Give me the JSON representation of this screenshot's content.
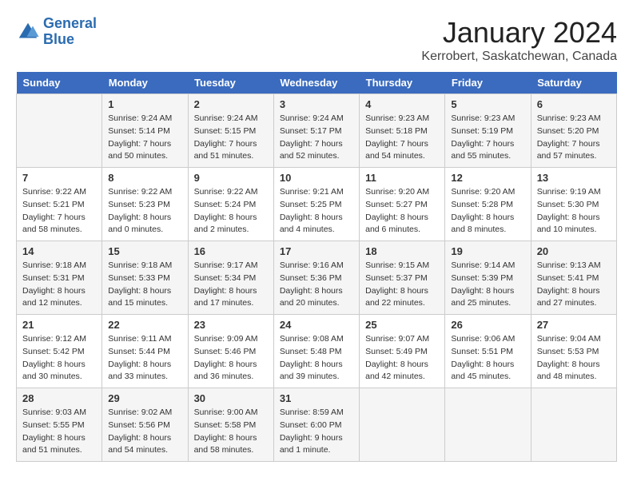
{
  "header": {
    "logo_line1": "General",
    "logo_line2": "Blue",
    "title": "January 2024",
    "location": "Kerrobert, Saskatchewan, Canada"
  },
  "days_of_week": [
    "Sunday",
    "Monday",
    "Tuesday",
    "Wednesday",
    "Thursday",
    "Friday",
    "Saturday"
  ],
  "weeks": [
    [
      {
        "day": "",
        "info": ""
      },
      {
        "day": "1",
        "info": "Sunrise: 9:24 AM\nSunset: 5:14 PM\nDaylight: 7 hours\nand 50 minutes."
      },
      {
        "day": "2",
        "info": "Sunrise: 9:24 AM\nSunset: 5:15 PM\nDaylight: 7 hours\nand 51 minutes."
      },
      {
        "day": "3",
        "info": "Sunrise: 9:24 AM\nSunset: 5:17 PM\nDaylight: 7 hours\nand 52 minutes."
      },
      {
        "day": "4",
        "info": "Sunrise: 9:23 AM\nSunset: 5:18 PM\nDaylight: 7 hours\nand 54 minutes."
      },
      {
        "day": "5",
        "info": "Sunrise: 9:23 AM\nSunset: 5:19 PM\nDaylight: 7 hours\nand 55 minutes."
      },
      {
        "day": "6",
        "info": "Sunrise: 9:23 AM\nSunset: 5:20 PM\nDaylight: 7 hours\nand 57 minutes."
      }
    ],
    [
      {
        "day": "7",
        "info": "Sunrise: 9:22 AM\nSunset: 5:21 PM\nDaylight: 7 hours\nand 58 minutes."
      },
      {
        "day": "8",
        "info": "Sunrise: 9:22 AM\nSunset: 5:23 PM\nDaylight: 8 hours\nand 0 minutes."
      },
      {
        "day": "9",
        "info": "Sunrise: 9:22 AM\nSunset: 5:24 PM\nDaylight: 8 hours\nand 2 minutes."
      },
      {
        "day": "10",
        "info": "Sunrise: 9:21 AM\nSunset: 5:25 PM\nDaylight: 8 hours\nand 4 minutes."
      },
      {
        "day": "11",
        "info": "Sunrise: 9:20 AM\nSunset: 5:27 PM\nDaylight: 8 hours\nand 6 minutes."
      },
      {
        "day": "12",
        "info": "Sunrise: 9:20 AM\nSunset: 5:28 PM\nDaylight: 8 hours\nand 8 minutes."
      },
      {
        "day": "13",
        "info": "Sunrise: 9:19 AM\nSunset: 5:30 PM\nDaylight: 8 hours\nand 10 minutes."
      }
    ],
    [
      {
        "day": "14",
        "info": "Sunrise: 9:18 AM\nSunset: 5:31 PM\nDaylight: 8 hours\nand 12 minutes."
      },
      {
        "day": "15",
        "info": "Sunrise: 9:18 AM\nSunset: 5:33 PM\nDaylight: 8 hours\nand 15 minutes."
      },
      {
        "day": "16",
        "info": "Sunrise: 9:17 AM\nSunset: 5:34 PM\nDaylight: 8 hours\nand 17 minutes."
      },
      {
        "day": "17",
        "info": "Sunrise: 9:16 AM\nSunset: 5:36 PM\nDaylight: 8 hours\nand 20 minutes."
      },
      {
        "day": "18",
        "info": "Sunrise: 9:15 AM\nSunset: 5:37 PM\nDaylight: 8 hours\nand 22 minutes."
      },
      {
        "day": "19",
        "info": "Sunrise: 9:14 AM\nSunset: 5:39 PM\nDaylight: 8 hours\nand 25 minutes."
      },
      {
        "day": "20",
        "info": "Sunrise: 9:13 AM\nSunset: 5:41 PM\nDaylight: 8 hours\nand 27 minutes."
      }
    ],
    [
      {
        "day": "21",
        "info": "Sunrise: 9:12 AM\nSunset: 5:42 PM\nDaylight: 8 hours\nand 30 minutes."
      },
      {
        "day": "22",
        "info": "Sunrise: 9:11 AM\nSunset: 5:44 PM\nDaylight: 8 hours\nand 33 minutes."
      },
      {
        "day": "23",
        "info": "Sunrise: 9:09 AM\nSunset: 5:46 PM\nDaylight: 8 hours\nand 36 minutes."
      },
      {
        "day": "24",
        "info": "Sunrise: 9:08 AM\nSunset: 5:48 PM\nDaylight: 8 hours\nand 39 minutes."
      },
      {
        "day": "25",
        "info": "Sunrise: 9:07 AM\nSunset: 5:49 PM\nDaylight: 8 hours\nand 42 minutes."
      },
      {
        "day": "26",
        "info": "Sunrise: 9:06 AM\nSunset: 5:51 PM\nDaylight: 8 hours\nand 45 minutes."
      },
      {
        "day": "27",
        "info": "Sunrise: 9:04 AM\nSunset: 5:53 PM\nDaylight: 8 hours\nand 48 minutes."
      }
    ],
    [
      {
        "day": "28",
        "info": "Sunrise: 9:03 AM\nSunset: 5:55 PM\nDaylight: 8 hours\nand 51 minutes."
      },
      {
        "day": "29",
        "info": "Sunrise: 9:02 AM\nSunset: 5:56 PM\nDaylight: 8 hours\nand 54 minutes."
      },
      {
        "day": "30",
        "info": "Sunrise: 9:00 AM\nSunset: 5:58 PM\nDaylight: 8 hours\nand 58 minutes."
      },
      {
        "day": "31",
        "info": "Sunrise: 8:59 AM\nSunset: 6:00 PM\nDaylight: 9 hours\nand 1 minute."
      },
      {
        "day": "",
        "info": ""
      },
      {
        "day": "",
        "info": ""
      },
      {
        "day": "",
        "info": ""
      }
    ]
  ]
}
